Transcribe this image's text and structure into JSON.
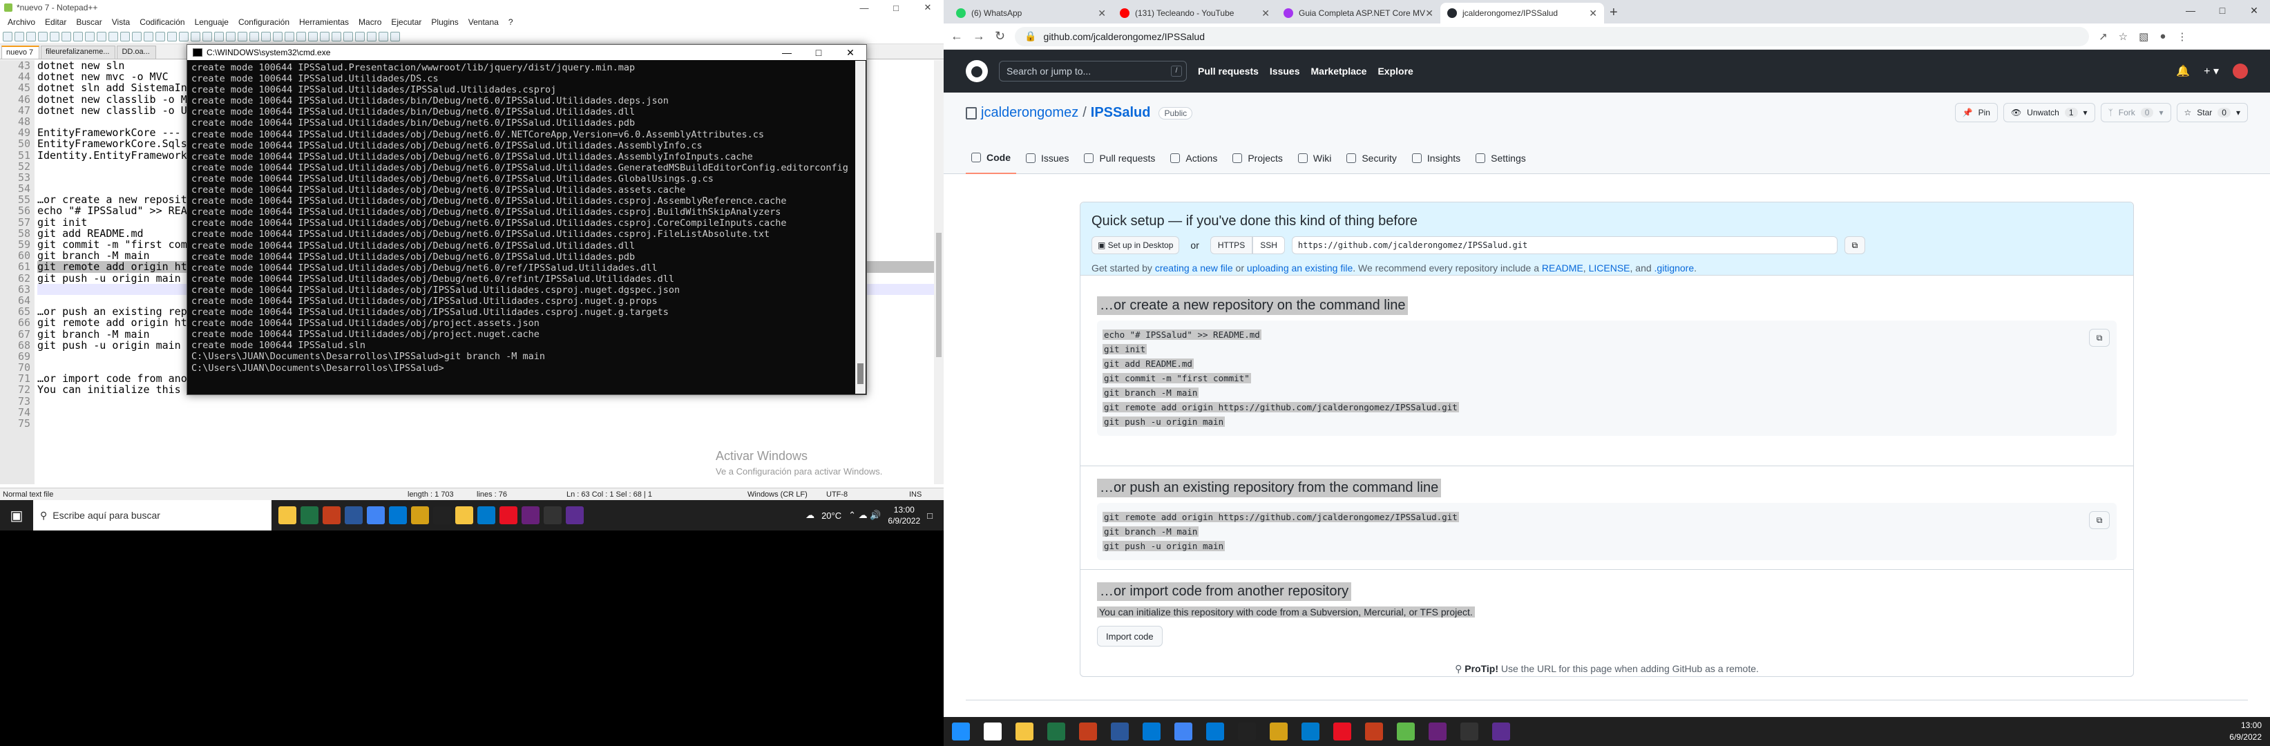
{
  "left": {
    "notepad": {
      "title": "*nuevo 7 - Notepad++",
      "menu": [
        "Archivo",
        "Editar",
        "Buscar",
        "Vista",
        "Codificación",
        "Lenguaje",
        "Configuración",
        "Herramientas",
        "Macro",
        "Ejecutar",
        "Plugins",
        "Ventana",
        "?"
      ],
      "tabs": [
        "nuevo 7",
        "fileurefalizaneme...",
        "DD.oa..."
      ],
      "line_numbers": [
        "43",
        "44",
        "45",
        "46",
        "47",
        "48",
        "49",
        "50",
        "51",
        "52",
        "53",
        "54",
        "55",
        "56",
        "57",
        "58",
        "59",
        "60",
        "61",
        "62",
        "63",
        "64",
        "65",
        "66",
        "67",
        "68",
        "69",
        "70",
        "71",
        "72",
        "73",
        "74",
        "75"
      ],
      "lines": [
        "dotnet new sln",
        "dotnet new mvc -o MVC",
        "dotnet sln add SistemaInv",
        "dotnet new classlib -o M",
        "dotnet new classlib -o U",
        "",
        "EntityFrameworkCore ---",
        "EntityFrameworkCore.Sqls",
        "Identity.EntityFramework",
        "",
        "",
        "",
        "…or create a new reposit",
        "echo \"# IPSSalud\" >> REA",
        "git init",
        "git add README.md",
        "git commit -m \"first com",
        "git branch -M main",
        "git remote add origin ht",
        "git push -u origin main",
        "",
        "",
        "…or push an existing rep",
        "git remote add origin ht",
        "git branch -M main",
        "git push -u origin main",
        "",
        "",
        "…or import code from another repository",
        "You can initialize this repository with code from a Subversion, Mercurial, or TFS project.",
        "",
        "",
        ""
      ],
      "status": {
        "type": "Normal text file",
        "length": "length : 1 703",
        "lines": "lines : 76",
        "pos": "Ln : 63    Col : 1    Sel : 68 | 1",
        "eol": "Windows (CR LF)",
        "enc": "UTF-8",
        "mode": "INS"
      },
      "activate_title": "Activar Windows",
      "activate_sub": "Ve a Configuración para activar Windows."
    },
    "cmd": {
      "title": "C:\\WINDOWS\\system32\\cmd.exe",
      "lines": [
        "create mode 100644 IPSSalud.Presentacion/wwwroot/lib/jquery/dist/jquery.min.map",
        "create mode 100644 IPSSalud.Utilidades/DS.cs",
        "create mode 100644 IPSSalud.Utilidades/IPSSalud.Utilidades.csproj",
        "create mode 100644 IPSSalud.Utilidades/bin/Debug/net6.0/IPSSalud.Utilidades.deps.json",
        "create mode 100644 IPSSalud.Utilidades/bin/Debug/net6.0/IPSSalud.Utilidades.dll",
        "create mode 100644 IPSSalud.Utilidades/bin/Debug/net6.0/IPSSalud.Utilidades.pdb",
        "create mode 100644 IPSSalud.Utilidades/obj/Debug/net6.0/.NETCoreApp,Version=v6.0.AssemblyAttributes.cs",
        "create mode 100644 IPSSalud.Utilidades/obj/Debug/net6.0/IPSSalud.Utilidades.AssemblyInfo.cs",
        "create mode 100644 IPSSalud.Utilidades/obj/Debug/net6.0/IPSSalud.Utilidades.AssemblyInfoInputs.cache",
        "create mode 100644 IPSSalud.Utilidades/obj/Debug/net6.0/IPSSalud.Utilidades.GeneratedMSBuildEditorConfig.editorconfig",
        "create mode 100644 IPSSalud.Utilidades/obj/Debug/net6.0/IPSSalud.Utilidades.GlobalUsings.g.cs",
        "create mode 100644 IPSSalud.Utilidades/obj/Debug/net6.0/IPSSalud.Utilidades.assets.cache",
        "create mode 100644 IPSSalud.Utilidades/obj/Debug/net6.0/IPSSalud.Utilidades.csproj.AssemblyReference.cache",
        "create mode 100644 IPSSalud.Utilidades/obj/Debug/net6.0/IPSSalud.Utilidades.csproj.BuildWithSkipAnalyzers",
        "create mode 100644 IPSSalud.Utilidades/obj/Debug/net6.0/IPSSalud.Utilidades.csproj.CoreCompileInputs.cache",
        "create mode 100644 IPSSalud.Utilidades/obj/Debug/net6.0/IPSSalud.Utilidades.csproj.FileListAbsolute.txt",
        "create mode 100644 IPSSalud.Utilidades/obj/Debug/net6.0/IPSSalud.Utilidades.dll",
        "create mode 100644 IPSSalud.Utilidades/obj/Debug/net6.0/IPSSalud.Utilidades.pdb",
        "create mode 100644 IPSSalud.Utilidades/obj/Debug/net6.0/ref/IPSSalud.Utilidades.dll",
        "create mode 100644 IPSSalud.Utilidades/obj/Debug/net6.0/refint/IPSSalud.Utilidades.dll",
        "create mode 100644 IPSSalud.Utilidades/obj/IPSSalud.Utilidades.csproj.nuget.dgspec.json",
        "create mode 100644 IPSSalud.Utilidades/obj/IPSSalud.Utilidades.csproj.nuget.g.props",
        "create mode 100644 IPSSalud.Utilidades/obj/IPSSalud.Utilidades.csproj.nuget.g.targets",
        "create mode 100644 IPSSalud.Utilidades/obj/project.assets.json",
        "create mode 100644 IPSSalud.Utilidades/obj/project.nuget.cache",
        "create mode 100644 IPSSalud.sln",
        "",
        "C:\\Users\\JUAN\\Documents\\Desarrollos\\IPSSalud>git branch -M main",
        "",
        "C:\\Users\\JUAN\\Documents\\Desarrollos\\IPSSalud>"
      ]
    },
    "taskbar": {
      "search_placeholder": "Escribe aquí para buscar",
      "temp": "20°C",
      "time": "13:00",
      "date": "6/9/2022"
    }
  },
  "right": {
    "browser": {
      "tabs": [
        {
          "label": "(6) WhatsApp",
          "color": "#25d366"
        },
        {
          "label": "(131) Tecleando - YouTube",
          "color": "#ff0000"
        },
        {
          "label": "Guia Completa ASP.NET Core MV",
          "color": "#a435f0"
        },
        {
          "label": "jcalderongomez/IPSSalud",
          "color": "#24292f"
        }
      ],
      "address": "github.com/jcalderongomez/IPSSalud"
    },
    "gh": {
      "search": "Search or jump to...",
      "search_key": "/",
      "links": [
        "Pull requests",
        "Issues",
        "Marketplace",
        "Explore"
      ],
      "owner": "jcalderongomez",
      "repo": "IPSSalud",
      "visibility": "Public",
      "actions": {
        "pin": "Pin",
        "watch": "Unwatch",
        "watch_count": "1",
        "fork": "Fork",
        "fork_count": "0",
        "star": "Star",
        "star_count": "0"
      },
      "nav": [
        "Code",
        "Issues",
        "Pull requests",
        "Actions",
        "Projects",
        "Wiki",
        "Security",
        "Insights",
        "Settings"
      ],
      "quick": {
        "title": "Quick setup — if you've done this kind of thing before",
        "desktop_btn": "Set up in Desktop",
        "or": "or",
        "https": "HTTPS",
        "ssh": "SSH",
        "url": "https://github.com/jcalderongomez/IPSSalud.git",
        "help_pre": "Get started by ",
        "help_link1": "creating a new file",
        "help_mid1": " or ",
        "help_link2": "uploading an existing file",
        "help_mid2": ". We recommend every repository include a ",
        "help_link3": "README",
        "help_sep1": ", ",
        "help_link4": "LICENSE",
        "help_sep2": ", and ",
        "help_link5": ".gitignore",
        "help_end": "."
      },
      "create": {
        "title": "…or create a new repository on the command line",
        "lines": [
          "echo \"# IPSSalud\" >> README.md",
          "git init",
          "git add README.md",
          "git commit -m \"first commit\"",
          "git branch -M main",
          "git remote add origin https://github.com/jcalderongomez/IPSSalud.git",
          "git push -u origin main"
        ]
      },
      "push": {
        "title": "…or push an existing repository from the command line",
        "lines": [
          "git remote add origin https://github.com/jcalderongomez/IPSSalud.git",
          "git branch -M main",
          "git push -u origin main"
        ]
      },
      "import": {
        "title": "…or import code from another repository",
        "text": "You can initialize this repository with code from a Subversion, Mercurial, or TFS project.",
        "button": "Import code"
      },
      "protip_label": "ProTip!",
      "protip": " Use the URL for this page when adding GitHub as a remote."
    },
    "taskbar": {
      "time": "13:00",
      "date": "6/9/2022"
    }
  }
}
